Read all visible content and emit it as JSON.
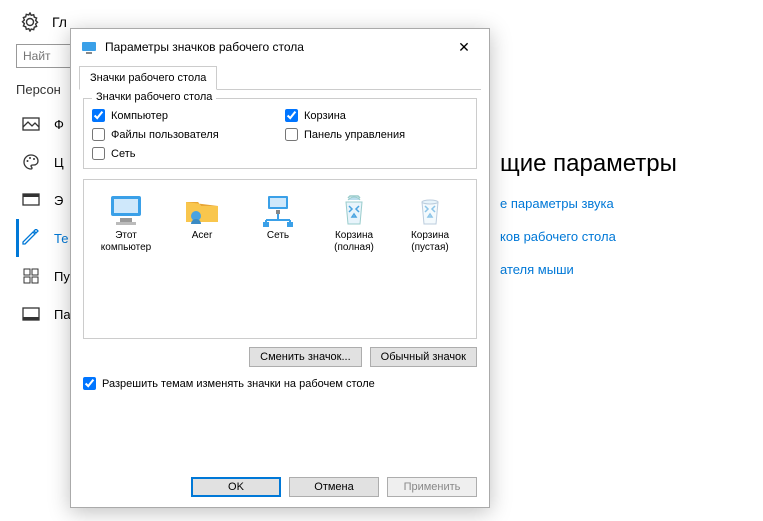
{
  "bg": {
    "title_partial": "Гл",
    "search_placeholder": "Найт",
    "section": "Персон",
    "nav": {
      "background": "Ф",
      "colors": "Ц",
      "lockscreen": "Э",
      "themes": "Те",
      "start": "Пу",
      "taskbar": "Па"
    },
    "right_title": "щие параметры",
    "links": {
      "sound": "е параметры звука",
      "desktop_icons": "ков рабочего стола",
      "mouse": "ателя мыши"
    }
  },
  "dialog": {
    "title": "Параметры значков рабочего стола",
    "tab": "Значки рабочего стола",
    "groupbox_title": "Значки рабочего стола",
    "checks": {
      "computer": {
        "label": "Компьютер",
        "checked": true
      },
      "recycle": {
        "label": "Корзина",
        "checked": true
      },
      "userfiles": {
        "label": "Файлы пользователя",
        "checked": false
      },
      "cpanel": {
        "label": "Панель управления",
        "checked": false
      },
      "network": {
        "label": "Сеть",
        "checked": false
      }
    },
    "icons": {
      "thispc": "Этот компьютер",
      "acer": "Acer",
      "network": "Сеть",
      "bin_full": "Корзина (полная)",
      "bin_empty": "Корзина (пустая)"
    },
    "btn_change": "Сменить значок...",
    "btn_default": "Обычный значок",
    "allow_themes": {
      "label": "Разрешить темам изменять значки на рабочем столе",
      "checked": true
    },
    "ok": "OK",
    "cancel": "Отмена",
    "apply": "Применить"
  }
}
